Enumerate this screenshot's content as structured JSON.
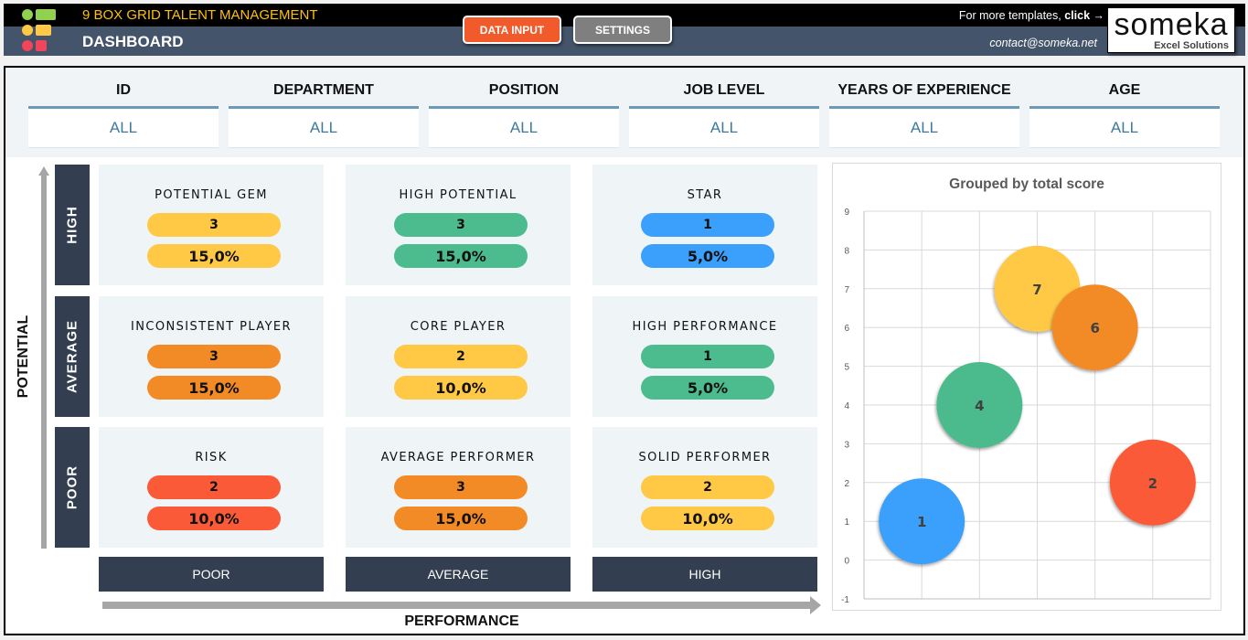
{
  "header": {
    "app_title": "9 BOX GRID TALENT MANAGEMENT",
    "page_title": "DASHBOARD",
    "buttons": {
      "data_input": "DATA INPUT",
      "settings": "SETTINGS"
    },
    "more_templates_prefix": "For more templates, ",
    "more_templates_link": "click →",
    "contact": "contact@someka.net",
    "brand": {
      "name": "someka",
      "tagline": "Excel Solutions"
    },
    "colors": {
      "title": "#ffc000",
      "data_input_button": "#f15a2b",
      "settings_button": "#7f7f7f"
    }
  },
  "filters": [
    {
      "label": "ID",
      "value": "ALL"
    },
    {
      "label": "DEPARTMENT",
      "value": "ALL"
    },
    {
      "label": "POSITION",
      "value": "ALL"
    },
    {
      "label": "JOB LEVEL",
      "value": "ALL"
    },
    {
      "label": "YEARS OF EXPERIENCE",
      "value": "ALL"
    },
    {
      "label": "AGE",
      "value": "ALL"
    }
  ],
  "grid": {
    "y_axis_title": "POTENTIAL",
    "x_axis_title": "PERFORMANCE",
    "rows": [
      "HIGH",
      "AVERAGE",
      "POOR"
    ],
    "columns": [
      "POOR",
      "AVERAGE",
      "HIGH"
    ],
    "cells": [
      {
        "title": "POTENTIAL GEM",
        "count": "3",
        "percent": "15,0%",
        "color": "#ffc845"
      },
      {
        "title": "HIGH POTENTIAL",
        "count": "3",
        "percent": "15,0%",
        "color": "#4cbb8e"
      },
      {
        "title": "STAR",
        "count": "1",
        "percent": "5,0%",
        "color": "#3ba0fb"
      },
      {
        "title": "INCONSISTENT PLAYER",
        "count": "3",
        "percent": "15,0%",
        "color": "#f28a25"
      },
      {
        "title": "CORE PLAYER",
        "count": "2",
        "percent": "10,0%",
        "color": "#ffc845"
      },
      {
        "title": "HIGH PERFORMANCE",
        "count": "1",
        "percent": "5,0%",
        "color": "#4cbb8e"
      },
      {
        "title": "RISK",
        "count": "2",
        "percent": "10,0%",
        "color": "#fa5a37"
      },
      {
        "title": "AVERAGE PERFORMER",
        "count": "3",
        "percent": "15,0%",
        "color": "#f28a25"
      },
      {
        "title": "SOLID PERFORMER",
        "count": "2",
        "percent": "10,0%",
        "color": "#ffc845"
      }
    ]
  },
  "chart_data": {
    "type": "scatter",
    "subtype": "bubble",
    "title": "Grouped by total score",
    "xlabel": "",
    "ylabel": "",
    "xlim": [
      0,
      6
    ],
    "ylim": [
      -1,
      9
    ],
    "yticks": [
      -1,
      0,
      1,
      2,
      3,
      4,
      5,
      6,
      7,
      8,
      9
    ],
    "x_tick_labels_visible": false,
    "grid": true,
    "points": [
      {
        "x": 1,
        "y": 1,
        "label": "1",
        "color": "#3ba0fb"
      },
      {
        "x": 2,
        "y": 4,
        "label": "4",
        "color": "#4cbb8e"
      },
      {
        "x": 3,
        "y": 7,
        "label": "7",
        "color": "#ffc845"
      },
      {
        "x": 4,
        "y": 6,
        "label": "6",
        "color": "#f28a25"
      },
      {
        "x": 5,
        "y": 2,
        "label": "2",
        "color": "#fa5a37"
      }
    ]
  }
}
